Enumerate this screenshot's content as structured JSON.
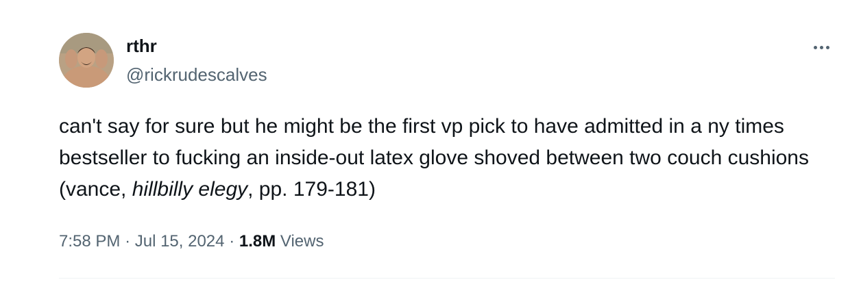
{
  "author": {
    "display_name": "rthr",
    "handle": "@rickrudescalves",
    "avatar_icon": "profile-photo"
  },
  "menu": {
    "icon": "more-options-icon"
  },
  "tweet": {
    "text_part1": "can't say for sure but he might be the first vp pick to have admitted in a ny times bestseller to fucking an inside-out latex glove shoved between two couch cushions (vance, ",
    "text_italic": "hillbilly elegy",
    "text_part2": ", pp. 179-181)"
  },
  "meta": {
    "time": "7:58 PM",
    "separator": "·",
    "date": "Jul 15, 2024",
    "views_count": "1.8M",
    "views_label": "Views"
  },
  "colors": {
    "text": "#0f1419",
    "secondary": "#536471",
    "divider": "#eff3f4"
  }
}
